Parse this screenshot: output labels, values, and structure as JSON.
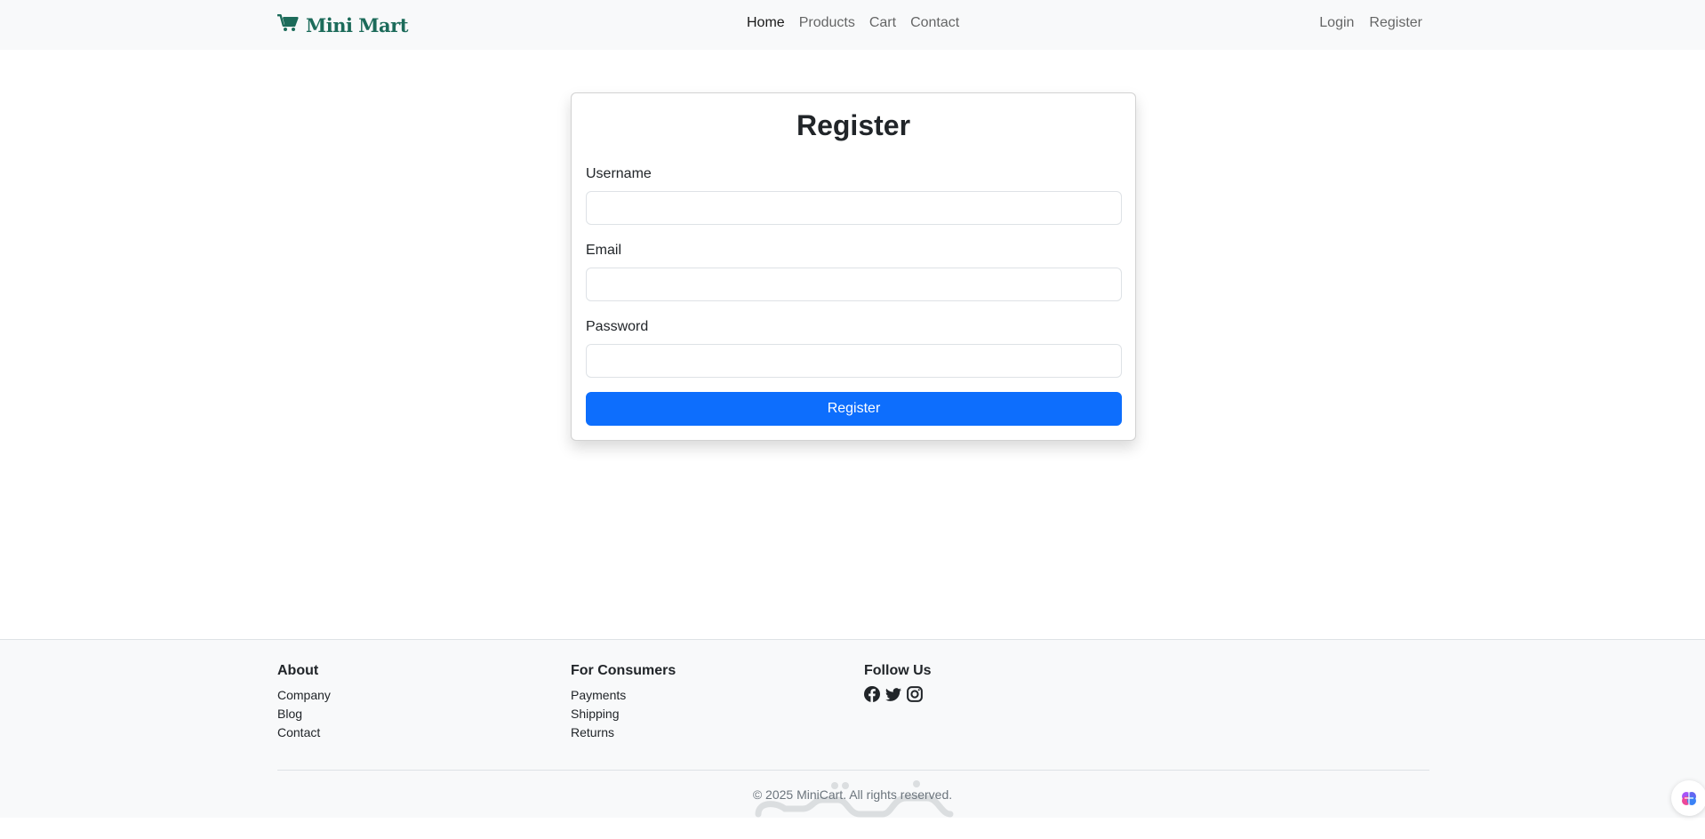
{
  "navbar": {
    "brand": "Mini Mart",
    "brand_icon": "cart-icon",
    "links": [
      "Home",
      "Products",
      "Cart",
      "Contact"
    ],
    "active_link": "Home",
    "auth_links": [
      "Login",
      "Register"
    ]
  },
  "form": {
    "title": "Register",
    "fields": [
      {
        "label": "Username",
        "value": ""
      },
      {
        "label": "Email",
        "value": ""
      },
      {
        "label": "Password",
        "value": ""
      }
    ],
    "submit_label": "Register",
    "submit_color": "#0d6efd"
  },
  "footer": {
    "columns": [
      {
        "heading": "About",
        "links": [
          "Company",
          "Blog",
          "Contact"
        ]
      },
      {
        "heading": "For Consumers",
        "links": [
          "Payments",
          "Shipping",
          "Returns"
        ]
      },
      {
        "heading": "Follow Us",
        "icons": [
          "facebook-icon",
          "twitter-icon",
          "instagram-icon"
        ]
      }
    ],
    "copyright": "© 2025 MiniCart. All rights reserved."
  },
  "colors": {
    "brand": "#1c6b5a",
    "primary": "#0d6efd",
    "navbar_bg": "#f8f9fa"
  }
}
